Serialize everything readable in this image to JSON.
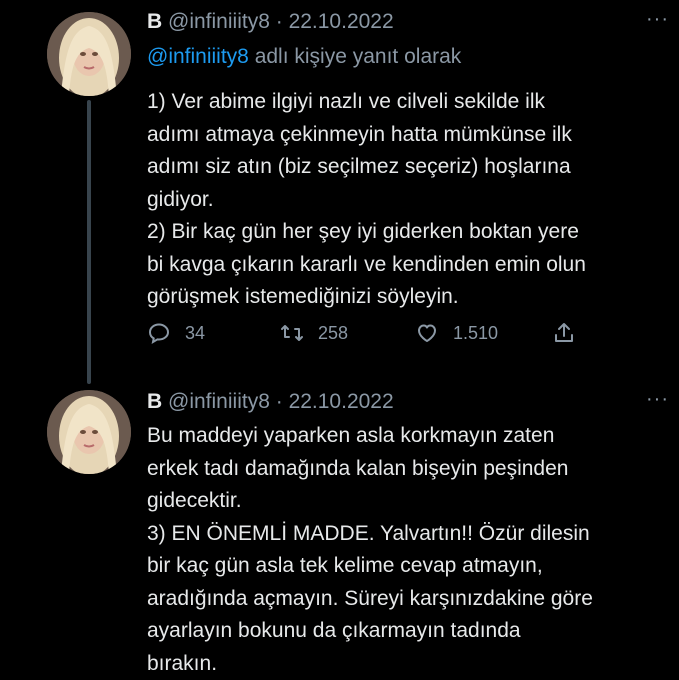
{
  "tweets": [
    {
      "name": "B",
      "handle": "@infiniiity8",
      "separator": "·",
      "date": "22.10.2022",
      "more": "···",
      "reply_to": {
        "mention": "@infiniiity8",
        "suffix": "adlı kişiye yanıt olarak"
      },
      "lines": [
        "1) Ver abime ilgiyi nazlı ve cilveli sekilde ilk",
        "adımı atmaya çekinmeyin hatta mümkünse ilk",
        "adımı siz atın (biz seçilmez seçeriz) hoşlarına",
        "gidiyor.",
        "2) Bir kaç gün her şey iyi giderken boktan yere",
        "bi kavga çıkarın kararlı ve kendinden emin olun",
        "görüşmek istemediğinizi söyleyin."
      ],
      "actions": {
        "replies": "34",
        "retweets": "258",
        "likes": "1.510"
      }
    },
    {
      "name": "B",
      "handle": "@infiniiity8",
      "separator": "·",
      "date": "22.10.2022",
      "more": "···",
      "lines": [
        "Bu maddeyi yaparken asla korkmayın zaten",
        "erkek tadı damağında kalan bişeyin peşinden",
        "gidecektir.",
        "3) EN ÖNEMLİ MADDE. Yalvartın!! Özür dilesin",
        "bir kaç gün asla tek kelime cevap atmayın,",
        "aradığında açmayın. Süreyi karşınızdakine göre",
        "ayarlayın bokunu da çıkarmayın tadında",
        "bırakın."
      ]
    }
  ],
  "icons": [
    "reply-icon",
    "retweet-icon",
    "like-icon",
    "share-icon",
    "more-icon"
  ],
  "colors": {
    "background": "#000000",
    "text": "#e7e9ea",
    "muted": "#8b98a5",
    "link": "#1d9bf0",
    "thread_line": "#38444d"
  }
}
